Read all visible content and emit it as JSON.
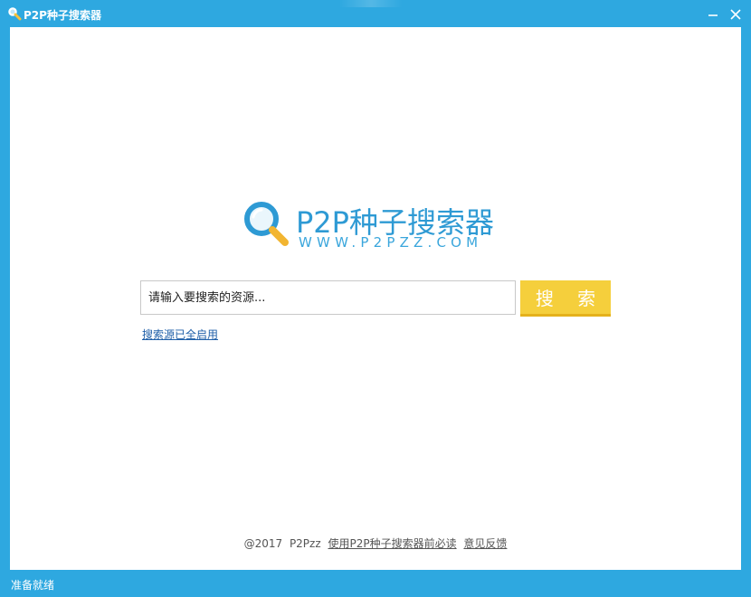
{
  "window": {
    "title": "P2P种子搜索器",
    "minimize_icon": "minimize-icon",
    "close_icon": "close-icon"
  },
  "logo": {
    "brand": "P2P种子搜索器",
    "site": "WWW.P2PZZ.COM",
    "icon": "magnifier-icon"
  },
  "search": {
    "placeholder": "请输入要搜索的资源...",
    "value": "",
    "button_label": "搜 索"
  },
  "source_link": "搜索源已全启用",
  "footer": {
    "copyright": "@2017",
    "brand": "P2Pzz",
    "read_first_link": "使用P2P种子搜索器前必读",
    "feedback_link": "意见反馈"
  },
  "status": {
    "text": "准备就绪"
  },
  "colors": {
    "frame": "#2ea8e0",
    "brand_blue": "#2e9ad4",
    "search_button": "#f5cf3c",
    "magnifier_handle": "#f2b531",
    "link": "#1f5fa8"
  }
}
